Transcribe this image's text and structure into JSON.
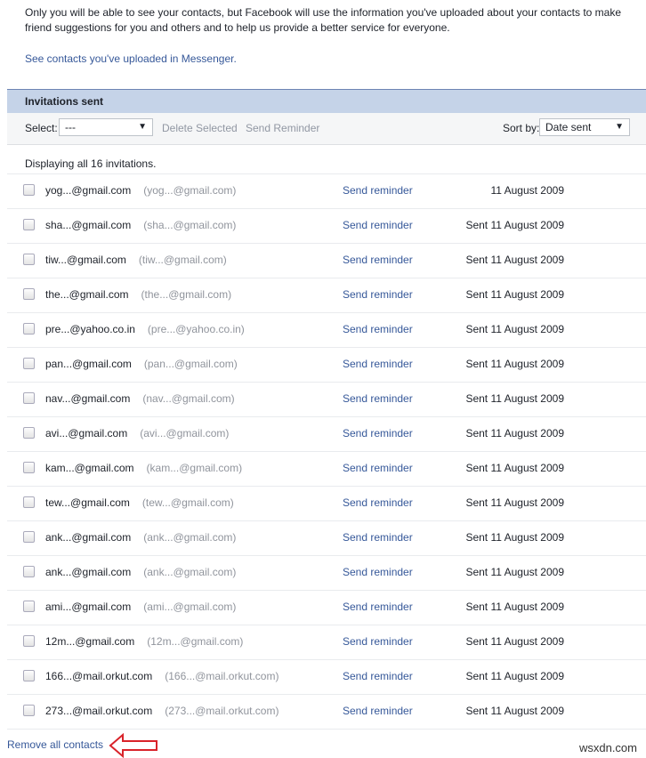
{
  "intro_text": "Only you will be able to see your contacts, but Facebook will use the information you've uploaded about your contacts to make friend suggestions for you and others and to help us provide a better service for everyone.",
  "messenger_link": "See contacts you've uploaded in Messenger.",
  "panel": {
    "title": "Invitations sent",
    "select_label": "Select:",
    "select_value": "---",
    "delete_selected": "Delete Selected",
    "send_reminder": "Send Reminder",
    "sort_label": "Sort by:",
    "sort_value": "Date sent",
    "displaying": "Displaying all 16 invitations."
  },
  "invitations": [
    {
      "email": "yog...@gmail.com",
      "alt": "(yog...@gmail.com)",
      "action": "Send reminder",
      "date": "11 August 2009"
    },
    {
      "email": "sha...@gmail.com",
      "alt": "(sha...@gmail.com)",
      "action": "Send reminder",
      "date": "Sent 11 August 2009"
    },
    {
      "email": "tiw...@gmail.com",
      "alt": "(tiw...@gmail.com)",
      "action": "Send reminder",
      "date": "Sent 11 August 2009"
    },
    {
      "email": "the...@gmail.com",
      "alt": "(the...@gmail.com)",
      "action": "Send reminder",
      "date": "Sent 11 August 2009"
    },
    {
      "email": "pre...@yahoo.co.in",
      "alt": "(pre...@yahoo.co.in)",
      "action": "Send reminder",
      "date": "Sent 11 August 2009"
    },
    {
      "email": "pan...@gmail.com",
      "alt": "(pan...@gmail.com)",
      "action": "Send reminder",
      "date": "Sent 11 August 2009"
    },
    {
      "email": "nav...@gmail.com",
      "alt": "(nav...@gmail.com)",
      "action": "Send reminder",
      "date": "Sent 11 August 2009"
    },
    {
      "email": "avi...@gmail.com",
      "alt": "(avi...@gmail.com)",
      "action": "Send reminder",
      "date": "Sent 11 August 2009"
    },
    {
      "email": "kam...@gmail.com",
      "alt": "(kam...@gmail.com)",
      "action": "Send reminder",
      "date": "Sent 11 August 2009"
    },
    {
      "email": "tew...@gmail.com",
      "alt": "(tew...@gmail.com)",
      "action": "Send reminder",
      "date": "Sent 11 August 2009"
    },
    {
      "email": "ank...@gmail.com",
      "alt": "(ank...@gmail.com)",
      "action": "Send reminder",
      "date": "Sent 11 August 2009"
    },
    {
      "email": "ank...@gmail.com",
      "alt": "(ank...@gmail.com)",
      "action": "Send reminder",
      "date": "Sent 11 August 2009"
    },
    {
      "email": "ami...@gmail.com",
      "alt": "(ami...@gmail.com)",
      "action": "Send reminder",
      "date": "Sent 11 August 2009"
    },
    {
      "email": "12m...@gmail.com",
      "alt": "(12m...@gmail.com)",
      "action": "Send reminder",
      "date": "Sent 11 August 2009"
    },
    {
      "email": "166...@mail.orkut.com",
      "alt": "(166...@mail.orkut.com)",
      "action": "Send reminder",
      "date": "Sent 11 August 2009"
    },
    {
      "email": "273...@mail.orkut.com",
      "alt": "(273...@mail.orkut.com)",
      "action": "Send reminder",
      "date": "Sent 11 August 2009"
    }
  ],
  "remove_all": "Remove all contacts",
  "watermark": "wsxdn.com"
}
